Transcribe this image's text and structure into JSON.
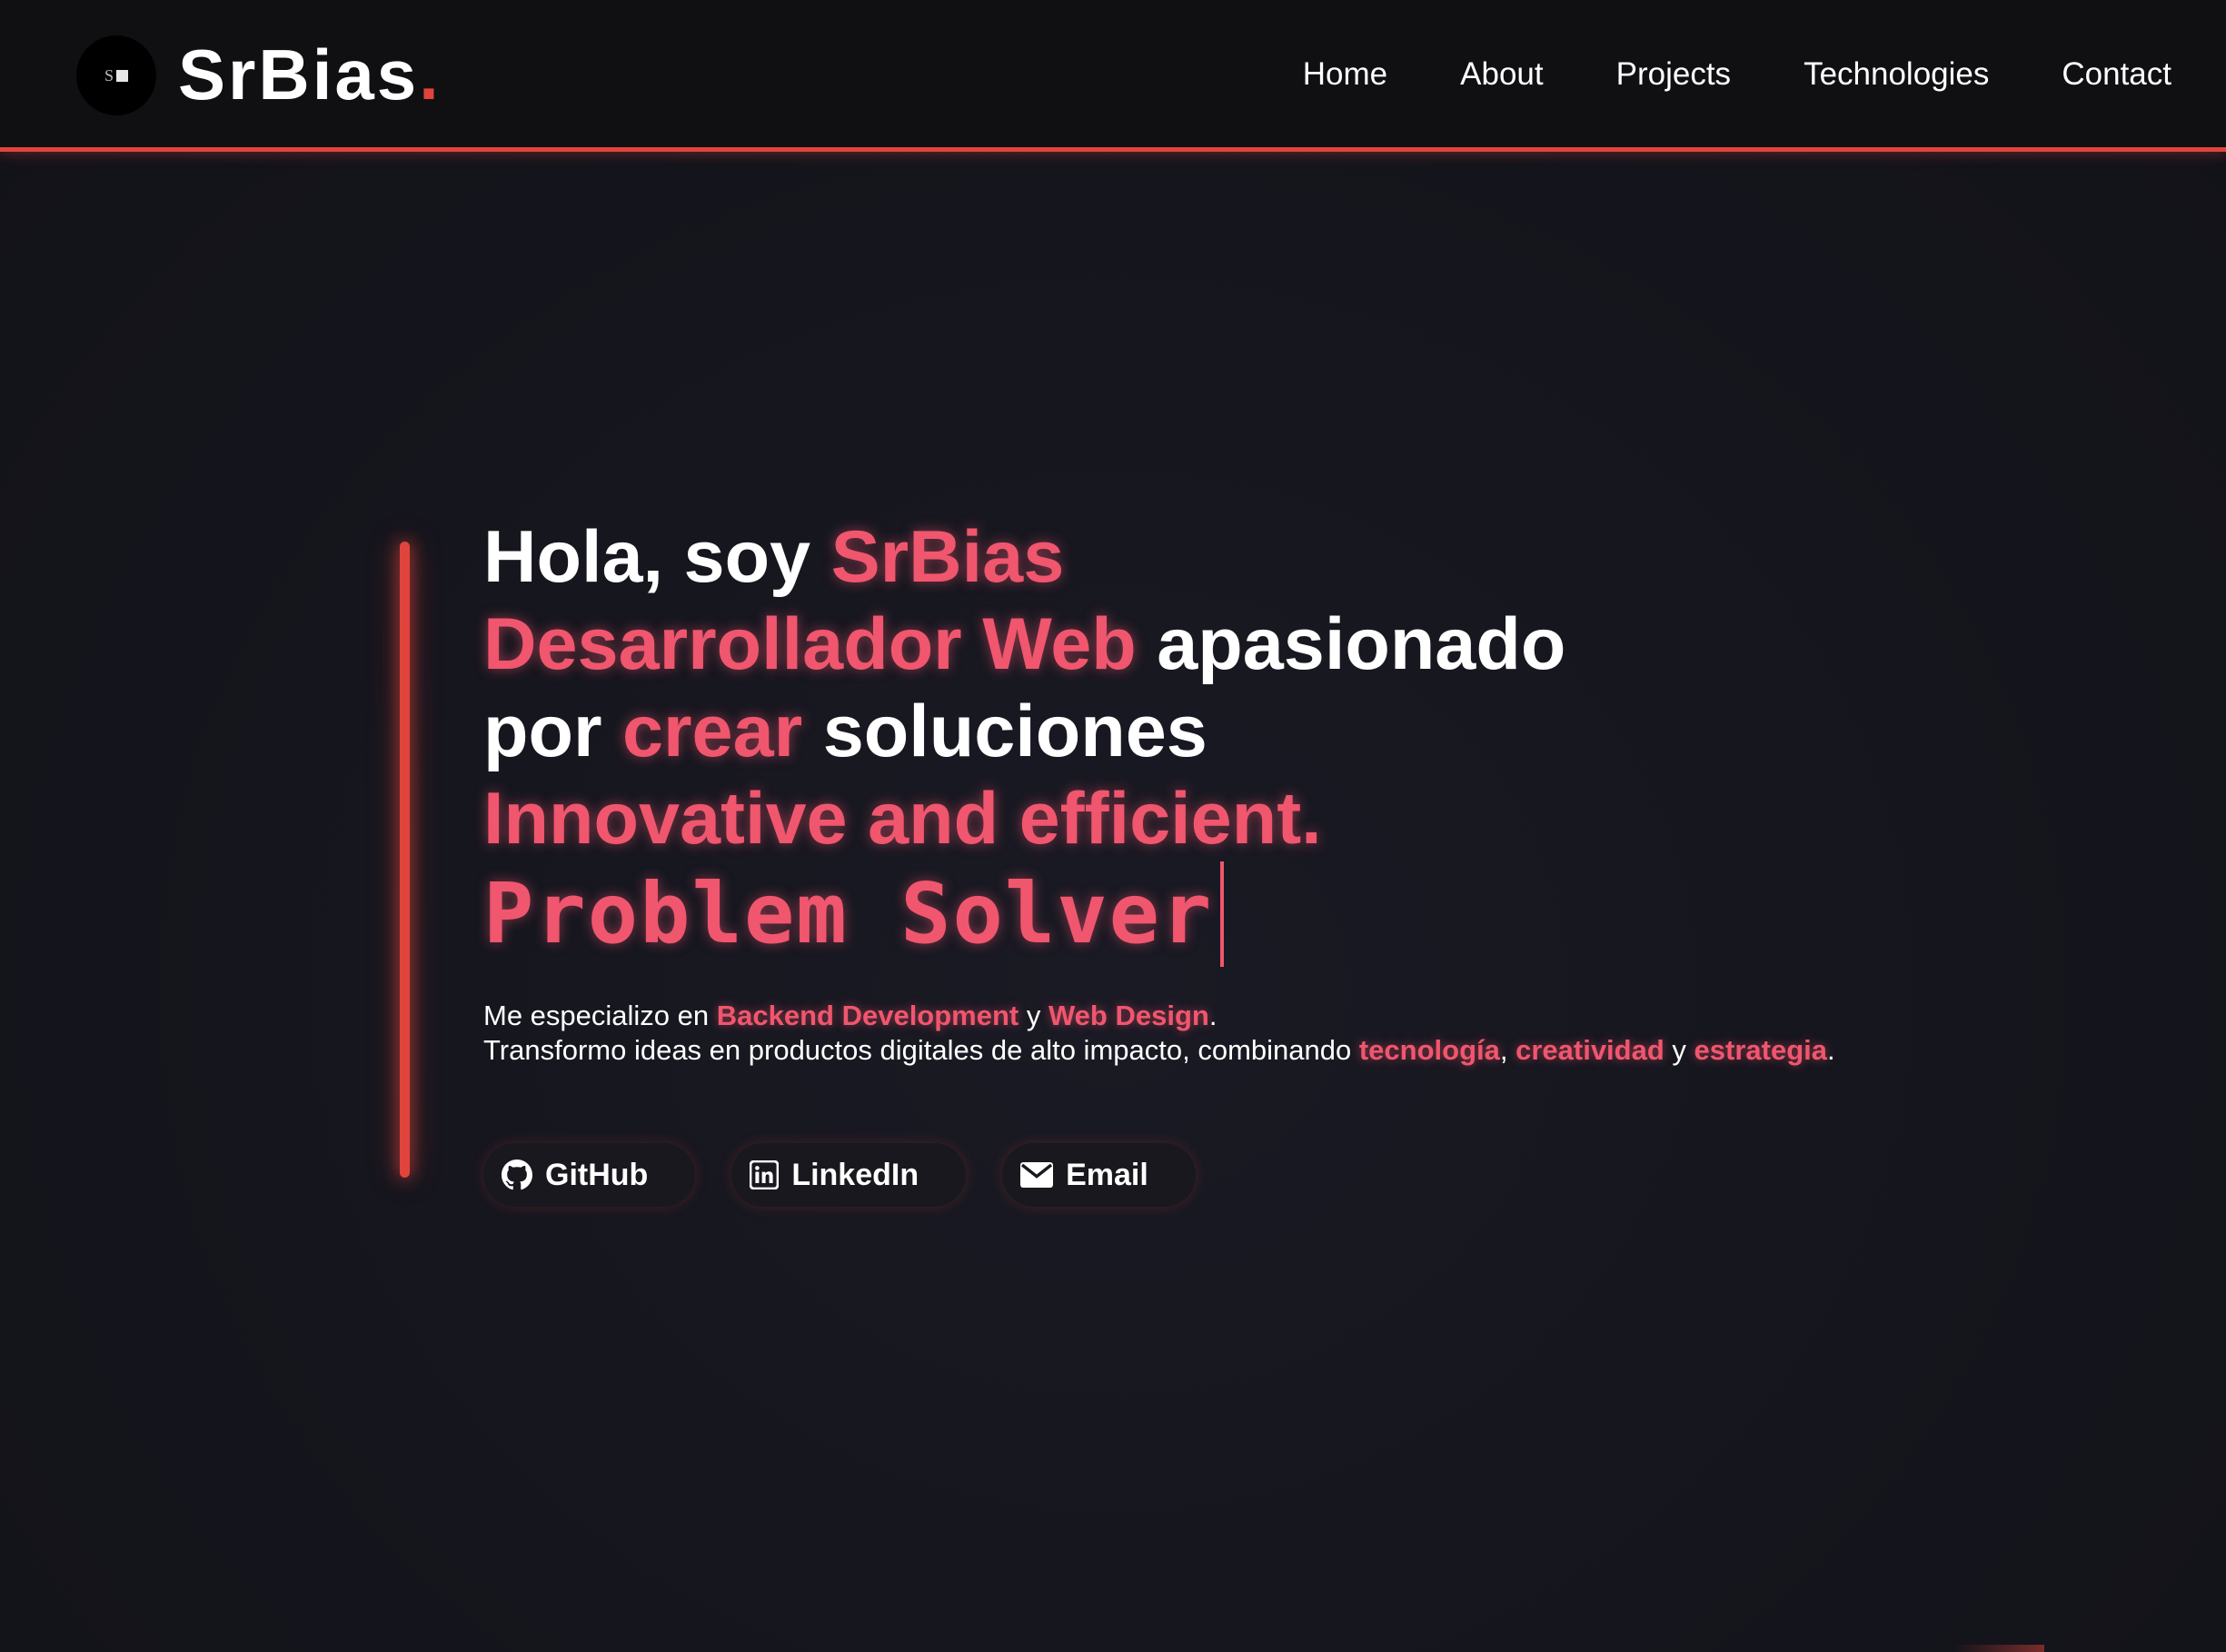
{
  "header": {
    "logo_icon": "srbias-logo-icon",
    "logo_text": "S",
    "brand_name": "SrBias",
    "brand_dot": ".",
    "nav": [
      {
        "label": "Home"
      },
      {
        "label": "About"
      },
      {
        "label": "Projects"
      },
      {
        "label": "Technologies"
      },
      {
        "label": "Contact"
      }
    ]
  },
  "hero": {
    "line1": {
      "pre": "Hola, soy ",
      "name": "SrBias"
    },
    "line2": {
      "role": "Desarrollador Web",
      "post": " apasionado"
    },
    "line3": {
      "pre": "por ",
      "verb": "crear",
      "post": " soluciones"
    },
    "line4": "Innovative and efficient.",
    "typewriter": "Problem Solver",
    "desc": {
      "line1": {
        "pre": "Me especializo en ",
        "skill1": "Backend Development",
        "mid": " y ",
        "skill2": "Web Design",
        "end": "."
      },
      "line2": {
        "pre": "Transformo ideas en productos digitales de alto impacto, combinando ",
        "w1": "tecnología",
        "sep1": ", ",
        "w2": "creatividad",
        "sep2": " y ",
        "w3": "estrategia",
        "end": "."
      }
    },
    "socials": [
      {
        "label": "GitHub",
        "icon": "github-icon"
      },
      {
        "label": "LinkedIn",
        "icon": "linkedin-icon"
      },
      {
        "label": "Email",
        "icon": "envelope-icon"
      }
    ]
  },
  "colors": {
    "accent": "#e0443c",
    "highlight": "#f0566e",
    "background": "#15151c",
    "header_bg": "#101013"
  }
}
